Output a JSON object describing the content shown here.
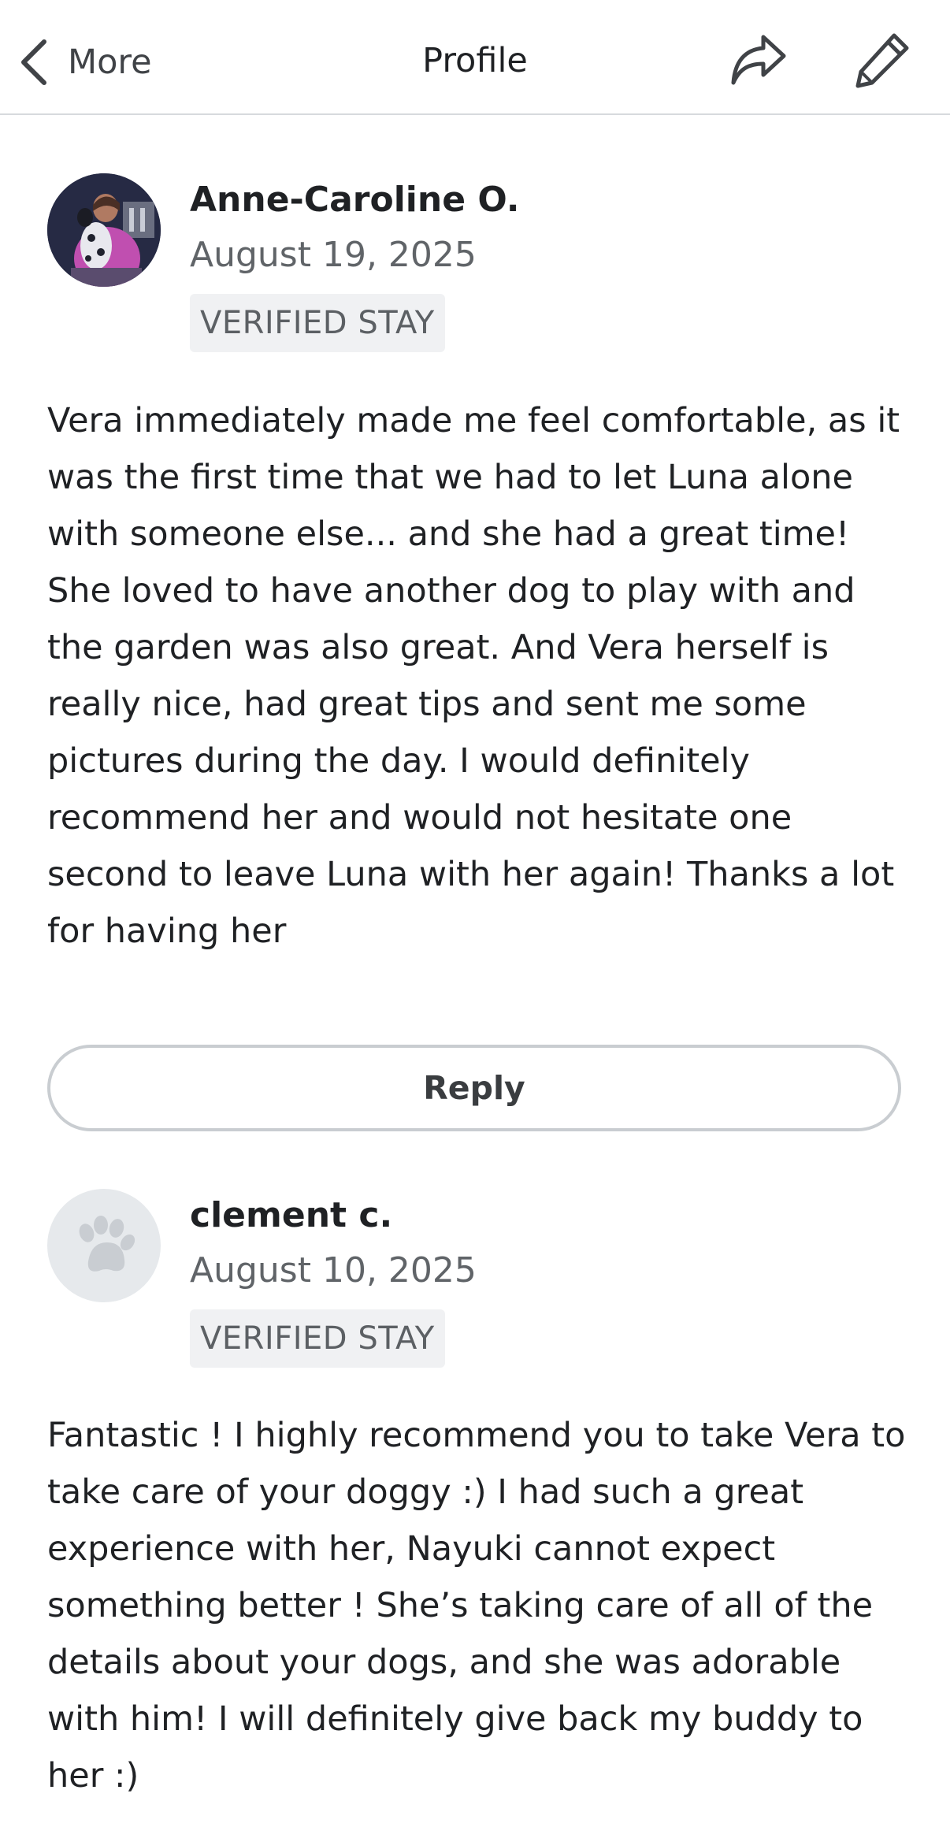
{
  "header": {
    "back_label": "More",
    "title": "Profile",
    "share_icon": "share-arrow-icon",
    "edit_icon": "pencil-icon"
  },
  "reviews": [
    {
      "name": "Anne-Caroline O.",
      "date": "August 19, 2025",
      "badge": "VERIFIED STAY",
      "avatar": "photo",
      "lines": [
        "Vera immediately made me feel comfortable, as it",
        "was the first time that we had to let Luna alone",
        "with someone else... and she had a great time!",
        "She loved to have another dog to play with and",
        "the garden was also great. And Vera herself is",
        "really nice, had great tips and sent me some",
        "pictures during the day. I would definitely",
        "recommend her and would not hesitate one",
        "second to leave Luna with her again! Thanks a lot",
        "for having her"
      ],
      "reply_label": "Reply"
    },
    {
      "name": "clement c.",
      "date": "August 10, 2025",
      "badge": "VERIFIED STAY",
      "avatar": "paw-placeholder-icon",
      "lines": [
        "Fantastic ! I highly recommend you to take Vera to",
        "take care of your doggy :) I had such a great",
        "experience with her, Nayuki cannot expect",
        "something better !  She’s taking care of all of the",
        "details about your dogs, and she was adorable",
        "with him! I will definitely give back my buddy to",
        "her :)"
      ]
    }
  ],
  "colors": {
    "text_primary": "#1f2124",
    "text_secondary": "#606468",
    "badge_bg": "#f0f1f3",
    "divider": "#d7dadd",
    "button_border": "#c9cdd1",
    "placeholder_bg": "#e6e9ec"
  }
}
